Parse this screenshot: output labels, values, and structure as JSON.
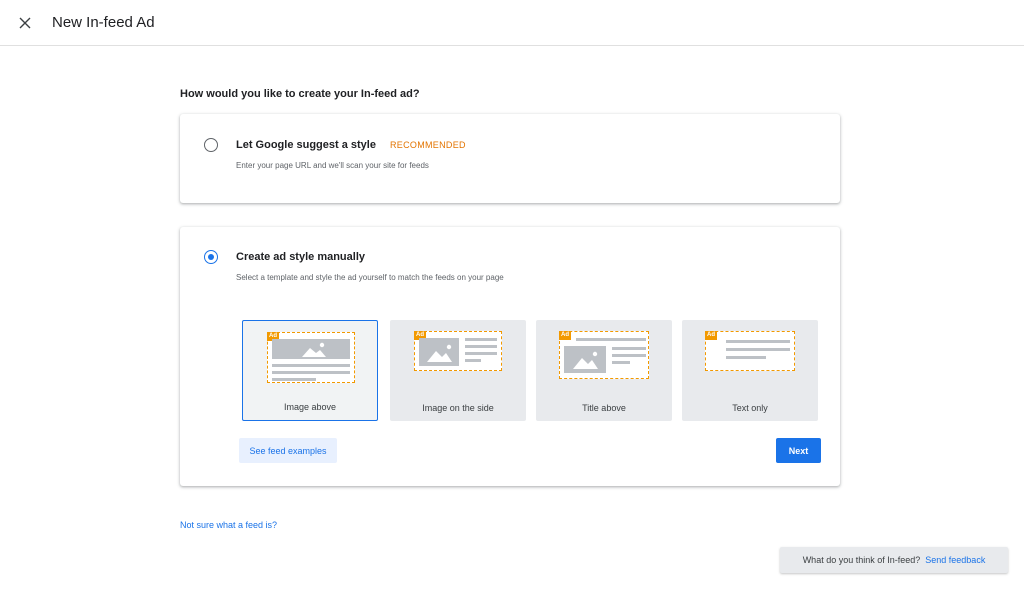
{
  "header": {
    "title": "New In-feed Ad",
    "close_icon": "close-icon"
  },
  "question": "How would you like to create your In-feed ad?",
  "options": {
    "suggest": {
      "title": "Let Google suggest a style",
      "badge": "RECOMMENDED",
      "description": "Enter your page URL and we'll scan your site for feeds",
      "checked": false
    },
    "manual": {
      "title": "Create ad style manually",
      "description": "Select a template and style the ad yourself to match the feeds on your page",
      "checked": true
    }
  },
  "templates": [
    {
      "label": "Image above",
      "selected": true
    },
    {
      "label": "Image on the side",
      "selected": false
    },
    {
      "label": "Title above",
      "selected": false
    },
    {
      "label": "Text only",
      "selected": false
    }
  ],
  "ad_tag": "Ad",
  "buttons": {
    "see_examples": "See feed examples",
    "next": "Next"
  },
  "help_link": "Not sure what a feed is?",
  "feedback": {
    "question": "What do you think of In-feed?",
    "link": "Send feedback"
  },
  "colors": {
    "accent": "#1a73e8",
    "badge": "#e37400",
    "ad_tag": "#f29900"
  }
}
